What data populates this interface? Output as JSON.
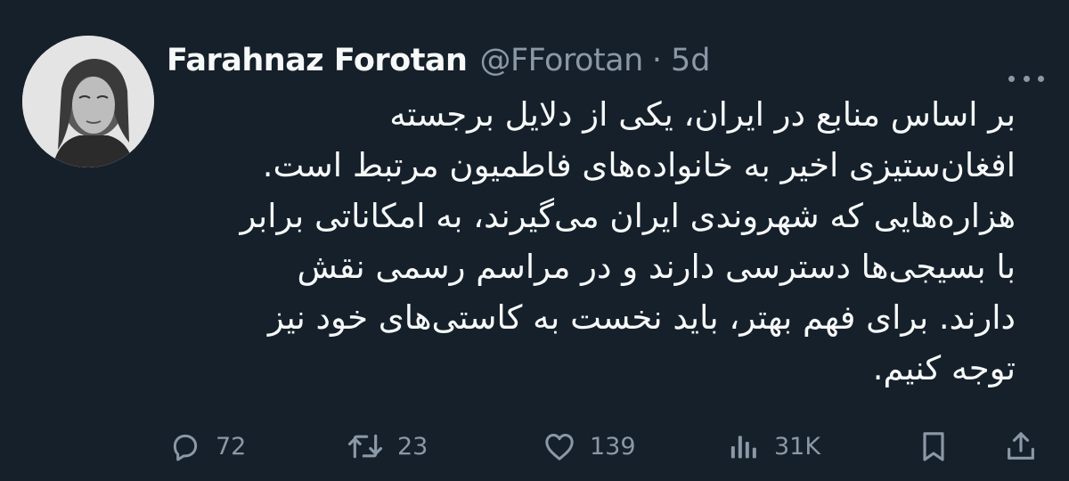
{
  "author": {
    "name": "Farahnaz Forotan",
    "handle": "@FForotan",
    "separator": "·",
    "time": "5d"
  },
  "tweet": {
    "lines": [
      "بر اساس منابع در ایران، یکی از دلایل برجسته",
      "افغان‌ستیزی اخیر به خانواده‌های فاطمیون مرتبط است.",
      "هزاره‌هایی که شهروندی ایران می‌گیرند، به امکاناتی برابر",
      "با بسیجی‌ها دسترسی دارند و در مراسم رسمی نقش",
      "دارند. برای فهم بهتر، باید نخست به کاستی‌های خود نیز",
      "توجه کنیم."
    ]
  },
  "actions": {
    "replies": "72",
    "reposts": "23",
    "likes": "139",
    "views": "31K"
  },
  "icons": {
    "reply": "reply-icon",
    "repost": "repost-icon",
    "like": "heart-icon",
    "views": "views-icon",
    "bookmark": "bookmark-icon",
    "share": "share-icon",
    "more": "more-icon"
  },
  "colors": {
    "background": "#15202b",
    "text": "#f7f9f9",
    "secondary": "#8b98a5"
  }
}
